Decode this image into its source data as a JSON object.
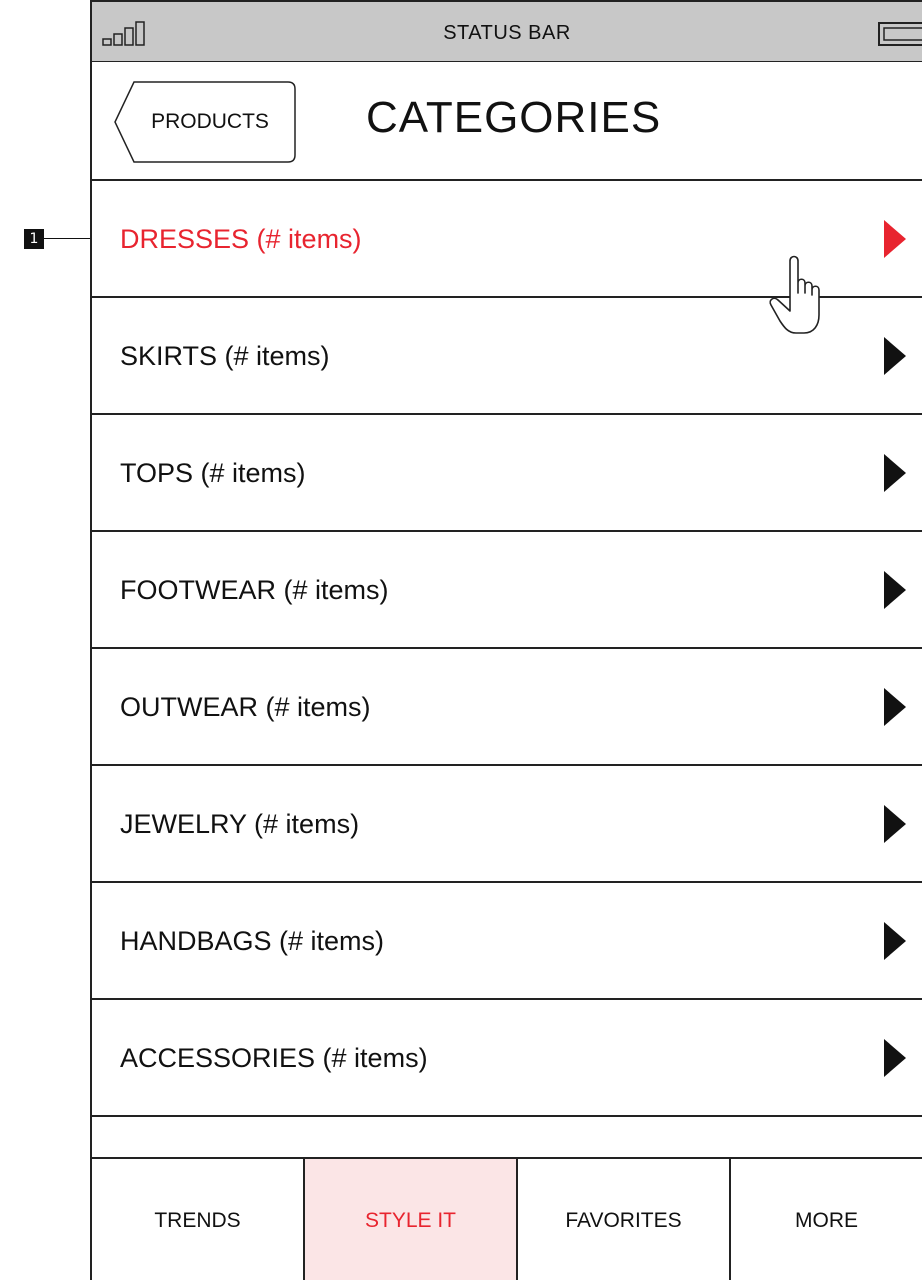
{
  "annotation": {
    "marker": "1"
  },
  "status_bar": {
    "label": "STATUS BAR"
  },
  "nav": {
    "back_label": "PRODUCTS",
    "title": "CATEGORIES"
  },
  "categories": [
    {
      "label": "DRESSES (# items)",
      "active": true
    },
    {
      "label": "SKIRTS (# items)",
      "active": false
    },
    {
      "label": "TOPS (# items)",
      "active": false
    },
    {
      "label": "FOOTWEAR (# items)",
      "active": false
    },
    {
      "label": "OUTWEAR (# items)",
      "active": false
    },
    {
      "label": "JEWELRY (# items)",
      "active": false
    },
    {
      "label": "HANDBAGS (# items)",
      "active": false
    },
    {
      "label": "ACCESSORIES (# items)",
      "active": false
    }
  ],
  "tabs": [
    {
      "label": "TRENDS",
      "selected": false
    },
    {
      "label": "STYLE IT",
      "selected": true
    },
    {
      "label": "FAVORITES",
      "selected": false
    },
    {
      "label": "MORE",
      "selected": false
    }
  ],
  "colors": {
    "accent": "#e8242f",
    "status_bar_bg": "#c8c8c8",
    "selected_tab_bg": "#fbe5e6"
  },
  "icons": [
    "signal-icon",
    "battery-icon",
    "chevron-right-icon",
    "hand-cursor-icon"
  ]
}
